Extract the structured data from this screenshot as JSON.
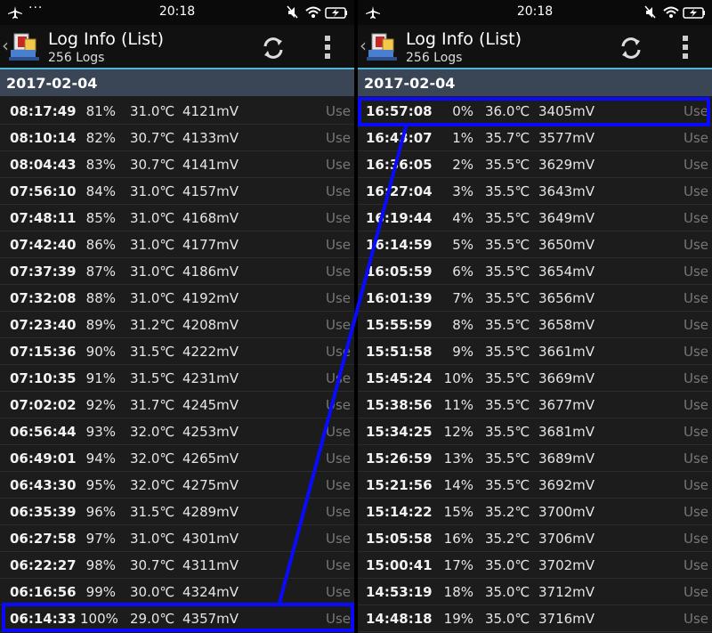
{
  "status_time": "20:18",
  "app": {
    "title": "Log Info (List)",
    "subtitle": "256 Logs"
  },
  "date_header": "2017-02-04",
  "use_label": "Use",
  "accent_color": "#4fb8d8",
  "highlight_color": "#0a0aff",
  "left_rows": [
    {
      "time": "08:17:49",
      "pct": "81%",
      "temp": "31.0℃",
      "mv": "4121mV"
    },
    {
      "time": "08:10:14",
      "pct": "82%",
      "temp": "30.7℃",
      "mv": "4133mV"
    },
    {
      "time": "08:04:43",
      "pct": "83%",
      "temp": "30.7℃",
      "mv": "4141mV"
    },
    {
      "time": "07:56:10",
      "pct": "84%",
      "temp": "31.0℃",
      "mv": "4157mV"
    },
    {
      "time": "07:48:11",
      "pct": "85%",
      "temp": "31.0℃",
      "mv": "4168mV"
    },
    {
      "time": "07:42:40",
      "pct": "86%",
      "temp": "31.0℃",
      "mv": "4177mV"
    },
    {
      "time": "07:37:39",
      "pct": "87%",
      "temp": "31.0℃",
      "mv": "4186mV"
    },
    {
      "time": "07:32:08",
      "pct": "88%",
      "temp": "31.0℃",
      "mv": "4192mV"
    },
    {
      "time": "07:23:40",
      "pct": "89%",
      "temp": "31.2℃",
      "mv": "4208mV"
    },
    {
      "time": "07:15:36",
      "pct": "90%",
      "temp": "31.5℃",
      "mv": "4222mV"
    },
    {
      "time": "07:10:35",
      "pct": "91%",
      "temp": "31.5℃",
      "mv": "4231mV"
    },
    {
      "time": "07:02:02",
      "pct": "92%",
      "temp": "31.7℃",
      "mv": "4245mV"
    },
    {
      "time": "06:56:44",
      "pct": "93%",
      "temp": "32.0℃",
      "mv": "4253mV"
    },
    {
      "time": "06:49:01",
      "pct": "94%",
      "temp": "32.0℃",
      "mv": "4265mV"
    },
    {
      "time": "06:43:30",
      "pct": "95%",
      "temp": "32.0℃",
      "mv": "4275mV"
    },
    {
      "time": "06:35:39",
      "pct": "96%",
      "temp": "31.5℃",
      "mv": "4289mV"
    },
    {
      "time": "06:27:58",
      "pct": "97%",
      "temp": "31.0℃",
      "mv": "4301mV"
    },
    {
      "time": "06:22:27",
      "pct": "98%",
      "temp": "30.7℃",
      "mv": "4311mV"
    },
    {
      "time": "06:16:56",
      "pct": "99%",
      "temp": "30.0℃",
      "mv": "4324mV"
    },
    {
      "time": "06:14:33",
      "pct": "100%",
      "temp": "29.0℃",
      "mv": "4357mV"
    }
  ],
  "right_rows": [
    {
      "time": "16:57:08",
      "pct": "0%",
      "temp": "36.0℃",
      "mv": "3405mV"
    },
    {
      "time": "16:43:07",
      "pct": "1%",
      "temp": "35.7℃",
      "mv": "3577mV"
    },
    {
      "time": "16:36:05",
      "pct": "2%",
      "temp": "35.5℃",
      "mv": "3629mV"
    },
    {
      "time": "16:27:04",
      "pct": "3%",
      "temp": "35.5℃",
      "mv": "3643mV"
    },
    {
      "time": "16:19:44",
      "pct": "4%",
      "temp": "35.5℃",
      "mv": "3649mV"
    },
    {
      "time": "16:14:59",
      "pct": "5%",
      "temp": "35.5℃",
      "mv": "3650mV"
    },
    {
      "time": "16:05:59",
      "pct": "6%",
      "temp": "35.5℃",
      "mv": "3654mV"
    },
    {
      "time": "16:01:39",
      "pct": "7%",
      "temp": "35.5℃",
      "mv": "3656mV"
    },
    {
      "time": "15:55:59",
      "pct": "8%",
      "temp": "35.5℃",
      "mv": "3658mV"
    },
    {
      "time": "15:51:58",
      "pct": "9%",
      "temp": "35.5℃",
      "mv": "3661mV"
    },
    {
      "time": "15:45:24",
      "pct": "10%",
      "temp": "35.5℃",
      "mv": "3669mV"
    },
    {
      "time": "15:38:56",
      "pct": "11%",
      "temp": "35.5℃",
      "mv": "3677mV"
    },
    {
      "time": "15:34:25",
      "pct": "12%",
      "temp": "35.5℃",
      "mv": "3681mV"
    },
    {
      "time": "15:26:59",
      "pct": "13%",
      "temp": "35.5℃",
      "mv": "3689mV"
    },
    {
      "time": "15:21:56",
      "pct": "14%",
      "temp": "35.5℃",
      "mv": "3692mV"
    },
    {
      "time": "15:14:22",
      "pct": "15%",
      "temp": "35.2℃",
      "mv": "3700mV"
    },
    {
      "time": "15:05:58",
      "pct": "16%",
      "temp": "35.2℃",
      "mv": "3706mV"
    },
    {
      "time": "15:00:41",
      "pct": "17%",
      "temp": "35.0℃",
      "mv": "3702mV"
    },
    {
      "time": "14:53:19",
      "pct": "18%",
      "temp": "35.0℃",
      "mv": "3712mV"
    },
    {
      "time": "14:48:18",
      "pct": "19%",
      "temp": "35.0℃",
      "mv": "3716mV"
    }
  ]
}
